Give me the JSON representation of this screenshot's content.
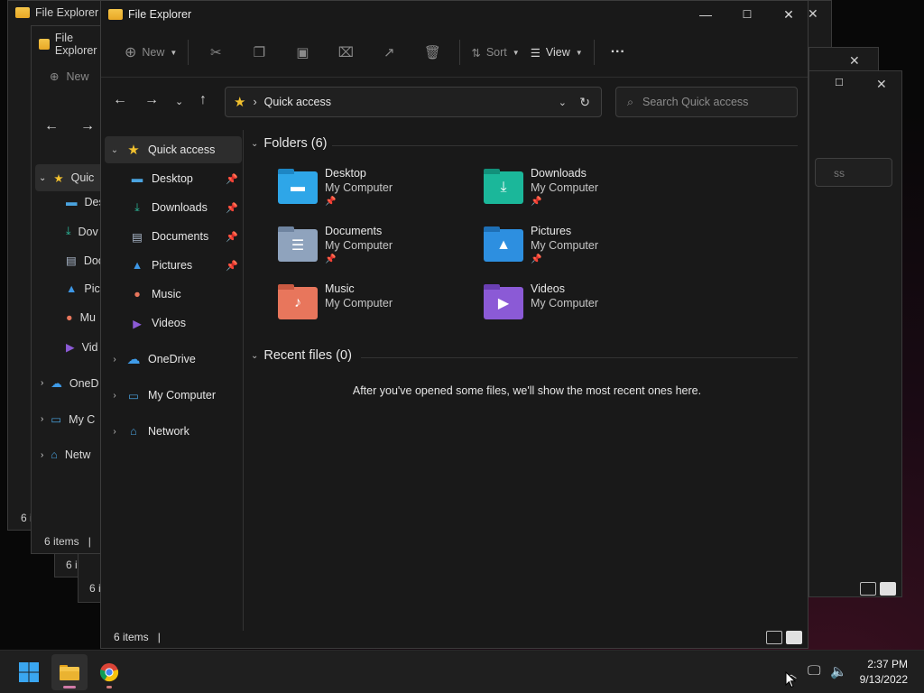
{
  "window": {
    "app_title": "File Explorer",
    "status_count": "6 items",
    "status_sep": "|"
  },
  "background_windows": {
    "win1_status": "6 i",
    "win2_status": "6 items",
    "win2_status_sep": "|",
    "win3_status": "6 i",
    "win4_status": "6 i",
    "win2_new": "New",
    "win2_nav": [
      "Quic",
      "Des",
      "Dov",
      "Doc",
      "Pict",
      "Mu",
      "Vid",
      "OneD",
      "My C",
      "Netw"
    ],
    "right_search_fragment": "ss"
  },
  "toolbar": {
    "new_label": "New",
    "sort_label": "Sort",
    "view_label": "View",
    "more_label": "···"
  },
  "address": {
    "location": "Quick access",
    "search_placeholder": "Search Quick access"
  },
  "navpane": {
    "quick_access": "Quick access",
    "pinned": [
      {
        "label": "Desktop",
        "icon": "desktop-icon"
      },
      {
        "label": "Downloads",
        "icon": "downloads-icon"
      },
      {
        "label": "Documents",
        "icon": "documents-icon"
      },
      {
        "label": "Pictures",
        "icon": "pictures-icon"
      },
      {
        "label": "Music",
        "icon": "music-icon"
      },
      {
        "label": "Videos",
        "icon": "videos-icon"
      }
    ],
    "onedrive": "OneDrive",
    "my_computer": "My Computer",
    "network": "Network"
  },
  "content": {
    "folders_header": "Folders (6)",
    "folders": [
      {
        "name": "Desktop",
        "location": "My Computer",
        "pinned": true,
        "color": "#2ea6e8"
      },
      {
        "name": "Downloads",
        "location": "My Computer",
        "pinned": true,
        "color": "#1bb79a"
      },
      {
        "name": "Documents",
        "location": "My Computer",
        "pinned": true,
        "color": "#8fa3bd"
      },
      {
        "name": "Pictures",
        "location": "My Computer",
        "pinned": true,
        "color": "#2d8fe0"
      },
      {
        "name": "Music",
        "location": "My Computer",
        "pinned": false,
        "color": "#e8765c"
      },
      {
        "name": "Videos",
        "location": "My Computer",
        "pinned": false,
        "color": "#8b5ad6"
      }
    ],
    "recent_header": "Recent files (0)",
    "recent_empty": "After you've opened some files, we'll show the most recent ones here."
  },
  "taskbar": {
    "time": "2:37 PM",
    "date": "9/13/2022",
    "apps": [
      "start-icon",
      "file-explorer-icon",
      "chrome-icon"
    ]
  }
}
